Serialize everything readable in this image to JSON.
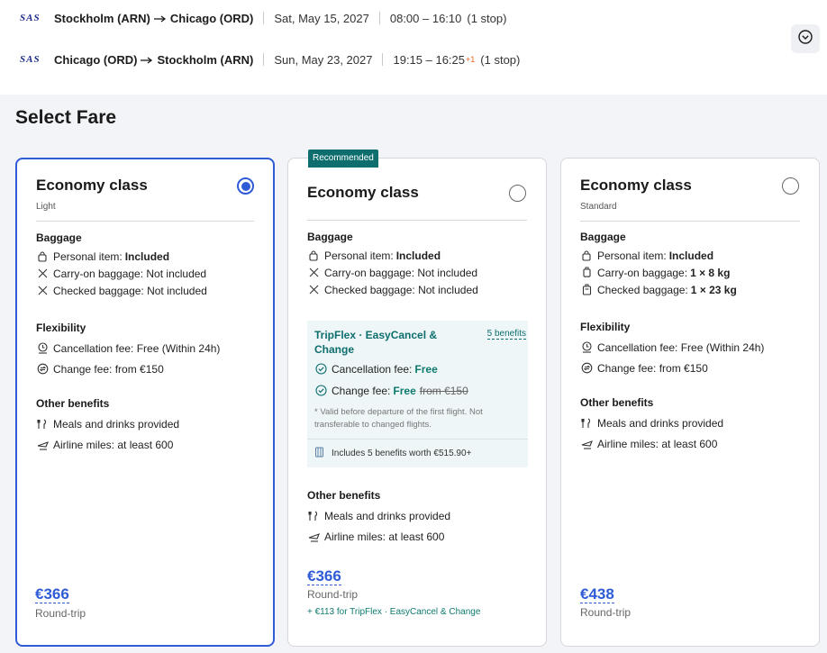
{
  "itinerary": {
    "outbound": {
      "airline": "SAS",
      "route_from": "Stockholm (ARN)",
      "route_to": "Chicago (ORD)",
      "date": "Sat, May 15, 2027",
      "time": "08:00 – 16:10",
      "stops": "(1 stop)"
    },
    "return": {
      "airline": "SAS",
      "route_from": "Chicago (ORD)",
      "route_to": "Stockholm (ARN)",
      "date": "Sun, May 23, 2027",
      "time": "19:15 – 16:25",
      "day_offset": "+1",
      "stops": "(1 stop)"
    },
    "expand_icon": "chevron-down-icon"
  },
  "section_title": "Select Fare",
  "accent_color": "#2f5bd6",
  "teal_color": "#0e6e6e",
  "fares": [
    {
      "title": "Economy class",
      "subtitle": "Light",
      "selected": true,
      "baggage_heading": "Baggage",
      "personal_item": "Personal item:",
      "personal_item_value": "Included",
      "carry_on": "Carry-on baggage: Not included",
      "checked": "Checked baggage: Not included",
      "flex_heading": "Flexibility",
      "cancellation": "Cancellation fee: Free (Within 24h)",
      "change": "Change fee: from €150",
      "other_heading": "Other benefits",
      "meals": "Meals and drinks provided",
      "miles": "Airline miles: at least 600",
      "price": "€366",
      "price_note": "Round-trip"
    },
    {
      "badge": "Recommended",
      "title": "Economy class",
      "subtitle": "",
      "selected": false,
      "baggage_heading": "Baggage",
      "personal_item": "Personal item:",
      "personal_item_value": "Included",
      "carry_on": "Carry-on baggage: Not included",
      "checked": "Checked baggage: Not included",
      "tripflex": {
        "title": "TripFlex · EasyCancel & Change",
        "benefits_link": "5 benefits",
        "cancellation_label": "Cancellation fee:",
        "cancellation_value": "Free",
        "change_label": "Change fee:",
        "change_value": "Free",
        "change_old": "from €150",
        "note": "* Valid before departure of the first flight. Not transferable to changed flights.",
        "includes": "Includes 5 benefits worth €515.90+"
      },
      "other_heading": "Other benefits",
      "meals": "Meals and drinks provided",
      "miles": "Airline miles: at least 600",
      "price": "€366",
      "price_note": "Round-trip",
      "addon": "+ €113 for TripFlex · EasyCancel & Change"
    },
    {
      "title": "Economy class",
      "subtitle": "Standard",
      "selected": false,
      "baggage_heading": "Baggage",
      "personal_item": "Personal item:",
      "personal_item_value": "Included",
      "carry_on_label": "Carry-on baggage:",
      "carry_on_value": "1 × 8 kg",
      "checked_label": "Checked baggage:",
      "checked_value": "1 × 23 kg",
      "flex_heading": "Flexibility",
      "cancellation": "Cancellation fee: Free (Within 24h)",
      "change": "Change fee: from €150",
      "other_heading": "Other benefits",
      "meals": "Meals and drinks provided",
      "miles": "Airline miles: at least 600",
      "price": "€438",
      "price_note": "Round-trip"
    }
  ]
}
